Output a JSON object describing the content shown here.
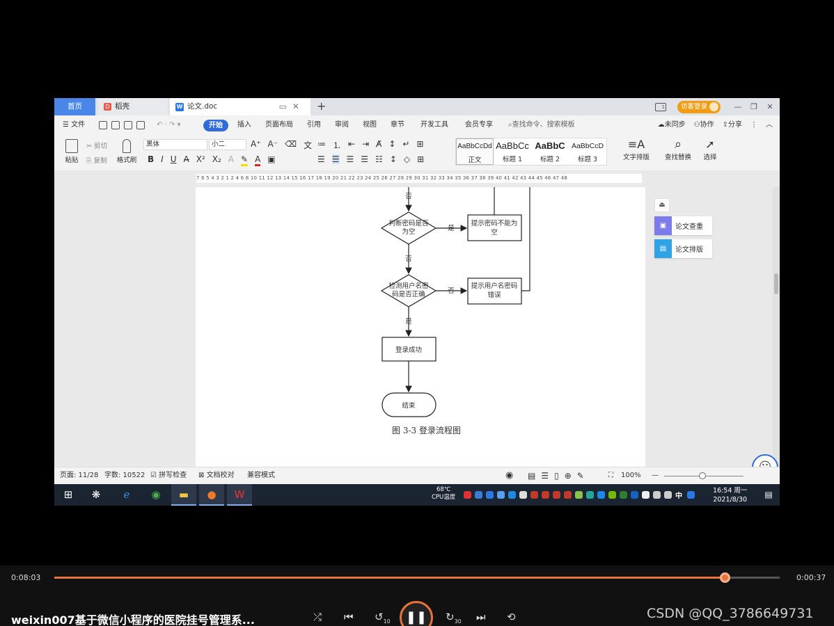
{
  "tabs": {
    "home": "首页",
    "doke": "稻壳",
    "doc": "论文.doc",
    "new_tab": "+"
  },
  "header": {
    "visitor_login": "访客登录"
  },
  "menu": {
    "file": "文件",
    "start": "开始",
    "insert": "插入",
    "page_layout": "页面布局",
    "reference": "引用",
    "review": "审阅",
    "view": "视图",
    "chapter": "章节",
    "dev_tools": "开发工具",
    "member": "会员专享",
    "search_placeholder": "查找命令、搜索模板",
    "not_synced": "未同步",
    "collaborate": "协作",
    "share": "分享"
  },
  "ribbon": {
    "paste": "粘贴",
    "cut": "剪切",
    "copy": "复制",
    "format_painter": "格式刷",
    "font_name": "黑体",
    "font_size": "小二",
    "styles": [
      {
        "sample": "AaBbCcDd",
        "label": "正文"
      },
      {
        "sample": "AaBbCc",
        "label": "标题 1"
      },
      {
        "sample": "AaBbC",
        "label": "标题 2"
      },
      {
        "sample": "AaBbCcD",
        "label": "标题 3"
      }
    ],
    "text_layout": "文字排版",
    "find_replace": "查找替换",
    "select": "选择"
  },
  "ruler": {
    "scale": "7 6 5 4 3 2 1  2  4 6 8 10 11 12 13 14 15 16 17 18 19 20 21 22 23 24 25 26 27 28 29 30 31 32 33 34 35 36 37 38 39 40 41 42 43 44 45 46 47 48"
  },
  "flowchart": {
    "label_no_top": "否",
    "decision1": [
      "判断密码是否",
      "为空"
    ],
    "yes1": "是",
    "box1": [
      "提示密码不能为",
      "空"
    ],
    "no2": "否",
    "decision2": [
      "检测用户名密",
      "码是否正确"
    ],
    "no3": "否",
    "box2": [
      "提示用户名密码",
      "错误"
    ],
    "yes2": "是",
    "success": "登录成功",
    "end": "结束",
    "caption": "图 3-3 登录流程图"
  },
  "side_panel": {
    "check": "论文查重",
    "layout": "论文排版"
  },
  "status": {
    "page": "页面: 11/28",
    "word_count": "字数: 10522",
    "spell_check": "拼写检查",
    "doc_proof": "文档校对",
    "compat_mode": "兼容模式",
    "zoom": "100%"
  },
  "taskbar": {
    "cpu_temp": "68℃",
    "cpu_label": "CPU温度",
    "time": "16:54 周一",
    "date": "2021/8/30",
    "ime": "中"
  },
  "player": {
    "elapsed": "0:08:03",
    "remaining": "0:00:37",
    "progress_fraction": 0.924,
    "title": "weixin007基于微信小程序的医院挂号管理系...",
    "watermark": "CSDN @QQ_3786649731",
    "rewind_label": "10",
    "forward_label": "30"
  },
  "colors": {
    "accent": "#2f6bd9",
    "player_accent": "#e8743b",
    "visitor_badge": "#f39c12"
  }
}
